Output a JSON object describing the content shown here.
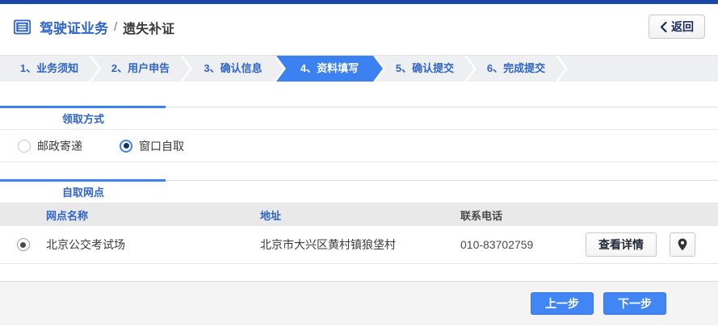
{
  "colors": {
    "top_bar": "#1849a9",
    "primary_blue": "#2f64c9",
    "active_step_blue": "#3b82f0",
    "nav_button_blue": "#4285f4",
    "table_header_bg": "#e9e9e9",
    "footer_bg": "#f4f4f4"
  },
  "header": {
    "icon": "document-list-icon",
    "title": "驾驶证业务",
    "separator": "/",
    "subtitle": "遗失补证",
    "back_label": "返回",
    "back_icon": "chevron-left-icon"
  },
  "steps": [
    {
      "label": "1、业务须知",
      "active": false
    },
    {
      "label": "2、用户申告",
      "active": false
    },
    {
      "label": "3、确认信息",
      "active": false
    },
    {
      "label": "4、资料填写",
      "active": true
    },
    {
      "label": "5、确认提交",
      "active": false
    },
    {
      "label": "6、完成提交",
      "active": false
    }
  ],
  "pickup_method": {
    "title": "领取方式",
    "options": [
      {
        "label": "邮政寄递",
        "selected": false
      },
      {
        "label": "窗口自取",
        "selected": true
      }
    ]
  },
  "pickup_site": {
    "title": "自取网点",
    "table": {
      "headers": {
        "name": "网点名称",
        "address": "地址",
        "phone": "联系电话"
      },
      "rows": [
        {
          "selected": true,
          "name": "北京公交考试场",
          "address": "北京市大兴区黄村镇狼垡村",
          "phone": "010-83702759",
          "detail_label": "查看详情",
          "map_icon": "location-pin-icon"
        }
      ]
    }
  },
  "footer": {
    "prev_label": "上一步",
    "next_label": "下一步"
  }
}
